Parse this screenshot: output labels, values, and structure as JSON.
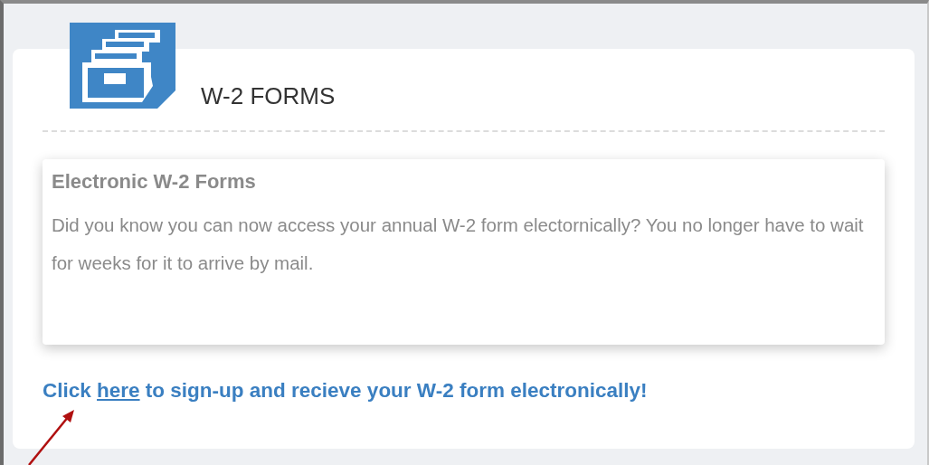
{
  "header": {
    "title": "W-2 FORMS"
  },
  "notice": {
    "heading": "Electronic W-2 Forms",
    "body": "Did you know you can now access your annual W-2 form electornically? You no longer have to wait for weeks for it to arrive by mail."
  },
  "call_to_action": {
    "before": "Click ",
    "link": "here",
    "after": " to sign-up and recieve your W-2 form electronically!"
  }
}
